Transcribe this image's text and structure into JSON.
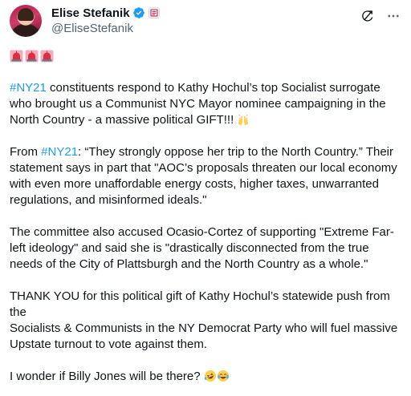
{
  "author": {
    "display_name": "Elise Stefanik",
    "handle": "@EliseStefanik",
    "verified_badge_color": "#1d9bf0",
    "affiliation_badge_color": "#e0245e"
  },
  "actions": {
    "grok_icon": "grok-icon",
    "more_icon": "more-icon"
  },
  "tweet": {
    "sirens": [
      "siren-emoji",
      "siren-emoji",
      "siren-emoji"
    ],
    "p1": {
      "hashtag": "#NY21",
      "line1_rest": " constituents respond to Kathy Hochul’s top Socialist surrogate",
      "line2": "who brought us a Communist NYC Mayor nominee campaigning in the",
      "line3": "North Country - a massive political GIFT!!! ",
      "emoji": "raising-hands-emoji"
    },
    "p2": {
      "prefix": "From ",
      "hashtag": "#NY21",
      "line1_rest": ": “They strongly oppose her trip to the North Country.” Their",
      "line2": "statement says in part that \"AOC’s proposals threaten our local economy",
      "line3": "with even more unaffordable energy costs, higher taxes, unwarranted",
      "line4": "regulations, and misinformed ideals.\""
    },
    "p3": {
      "line1": "The committee also accused Ocasio-Cortez of supporting \"Extreme Far-",
      "line2": "left ideology\" and said she is \"drastically disconnected from the true",
      "line3": "needs of the City of Plattsburgh and the North Country as a whole.\""
    },
    "p4": {
      "line1": "THANK YOU for this political gift of Kathy Hochul’s statewide push from",
      "line2": "the",
      "line3": "Socialists & Communists in the NY Democrat Party who will fuel massive",
      "line4": "Upstate turnout to vote against them."
    },
    "p5": {
      "text": "I wonder if Billy Jones will be there? ",
      "emojis": [
        "rofl-emoji",
        "joy-emoji"
      ]
    }
  },
  "colors": {
    "link": "#1d9bf0",
    "text": "#0f1419",
    "secondary": "#536471"
  }
}
